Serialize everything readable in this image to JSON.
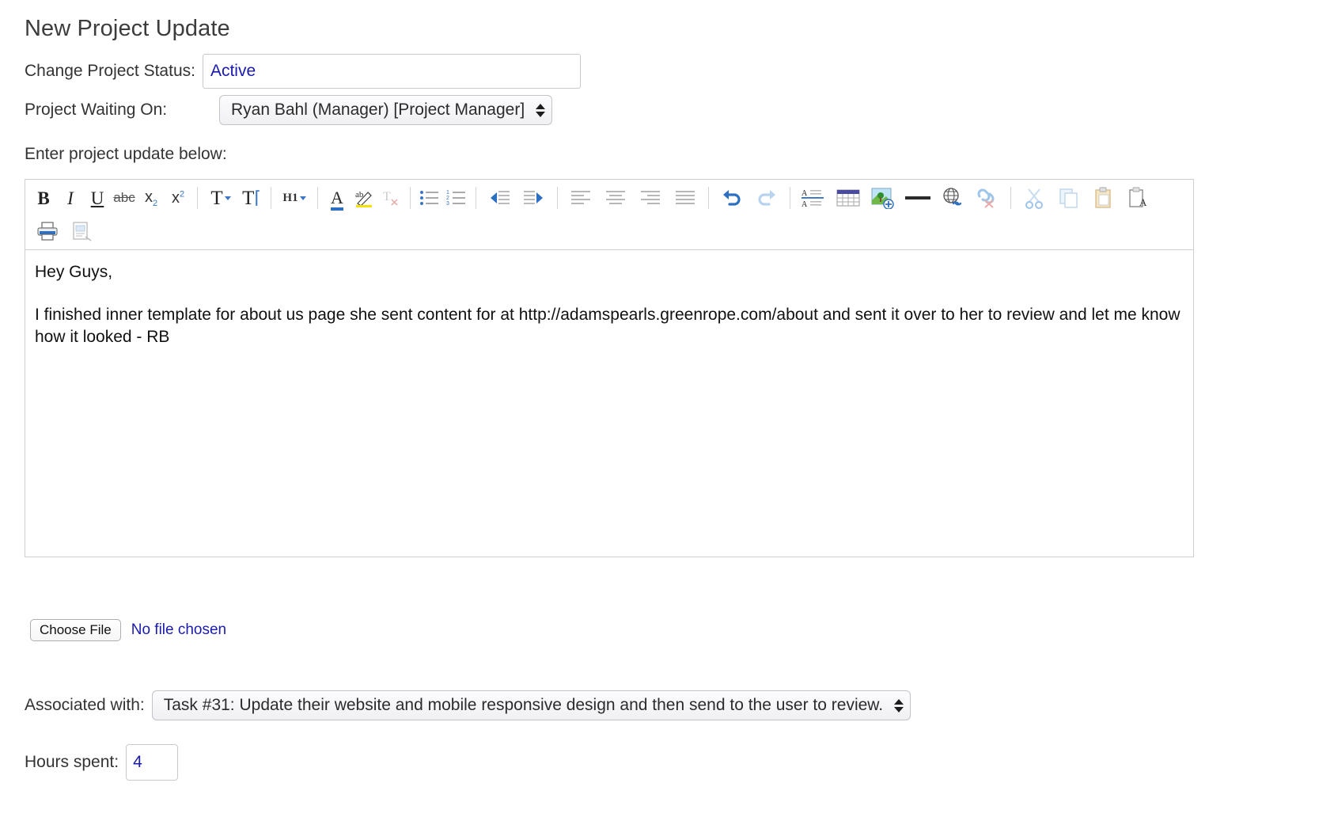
{
  "form": {
    "title": "New Project Update",
    "status": {
      "label": "Change Project Status:",
      "value": "Active",
      "placeholder": ""
    },
    "waiting_on": {
      "label": "Project Waiting On:",
      "value": "Ryan Bahl (Manager) [Project Manager]"
    },
    "update_prompt": "Enter project update below:",
    "attachment": {
      "button_label": "Choose File",
      "status_text": "No file chosen"
    },
    "associated_with": {
      "label": "Associated with:",
      "value": "Task #31: Update their website and mobile responsive design and then send to the user to review."
    },
    "hours": {
      "label": "Hours spent:",
      "value": "4"
    }
  },
  "editor": {
    "body_paragraphs": [
      "Hey Guys,",
      "I finished inner template for about us page she sent content for at http://adamspearls.greenrope.com/about and sent it over to her to review and let me know how it looked - RB"
    ],
    "toolbar_rows": [
      {
        "groups": [
          {
            "items": [
              {
                "name": "bold-icon",
                "label": "B"
              },
              {
                "name": "italic-icon",
                "label": "I"
              },
              {
                "name": "underline-icon",
                "label": "U"
              },
              {
                "name": "strikethrough-icon",
                "label": "abc"
              },
              {
                "name": "subscript-icon",
                "label": "x2"
              },
              {
                "name": "superscript-icon",
                "label": "x2"
              }
            ]
          },
          {
            "items": [
              {
                "name": "font-size-icon",
                "label": "T"
              },
              {
                "name": "font-family-icon",
                "label": "T"
              }
            ]
          },
          {
            "items": [
              {
                "name": "heading-format-icon",
                "label": "H1"
              }
            ]
          },
          {
            "items": [
              {
                "name": "text-color-icon",
                "label": "A"
              },
              {
                "name": "highlight-color-icon",
                "label": "ab"
              },
              {
                "name": "remove-format-icon",
                "label": "Tx"
              }
            ]
          },
          {
            "items": [
              {
                "name": "bulleted-list-icon",
                "label": "Bulleted list"
              },
              {
                "name": "numbered-list-icon",
                "label": "Numbered list"
              }
            ]
          },
          {
            "items": [
              {
                "name": "outdent-icon",
                "label": "Decrease indent"
              },
              {
                "name": "indent-icon",
                "label": "Increase indent"
              }
            ]
          },
          {
            "items": [
              {
                "name": "align-left-icon",
                "label": "Align left"
              },
              {
                "name": "align-center-icon",
                "label": "Align center"
              },
              {
                "name": "align-right-icon",
                "label": "Align right"
              },
              {
                "name": "align-justify-icon",
                "label": "Justify"
              }
            ]
          },
          {
            "items": [
              {
                "name": "undo-icon",
                "label": "Undo"
              },
              {
                "name": "redo-icon",
                "label": "Redo"
              }
            ]
          },
          {
            "items": [
              {
                "name": "line-height-icon",
                "label": "Line height"
              },
              {
                "name": "insert-table-icon",
                "label": "Insert table"
              },
              {
                "name": "insert-image-icon",
                "label": "Insert image"
              },
              {
                "name": "horizontal-rule-icon",
                "label": "Horizontal rule"
              },
              {
                "name": "insert-link-icon",
                "label": "Insert link"
              },
              {
                "name": "unlink-icon",
                "label": "Unlink"
              }
            ]
          },
          {
            "items": [
              {
                "name": "cut-icon",
                "label": "Cut"
              },
              {
                "name": "copy-icon",
                "label": "Copy"
              },
              {
                "name": "paste-icon",
                "label": "Paste"
              },
              {
                "name": "paste-as-text-icon",
                "label": "Paste as plain text"
              }
            ]
          }
        ]
      },
      {
        "groups": [
          {
            "items": [
              {
                "name": "print-icon",
                "label": "Print"
              },
              {
                "name": "preview-icon",
                "label": "Preview"
              }
            ]
          }
        ]
      }
    ]
  },
  "colors": {
    "link_blue": "#1a1aaf",
    "accent_blue": "#3a76c4",
    "border_gray": "#cfcfcf",
    "text_dark": "#333333",
    "underline_red": "#e0706a",
    "highlight_yellow": "#f5e106"
  }
}
